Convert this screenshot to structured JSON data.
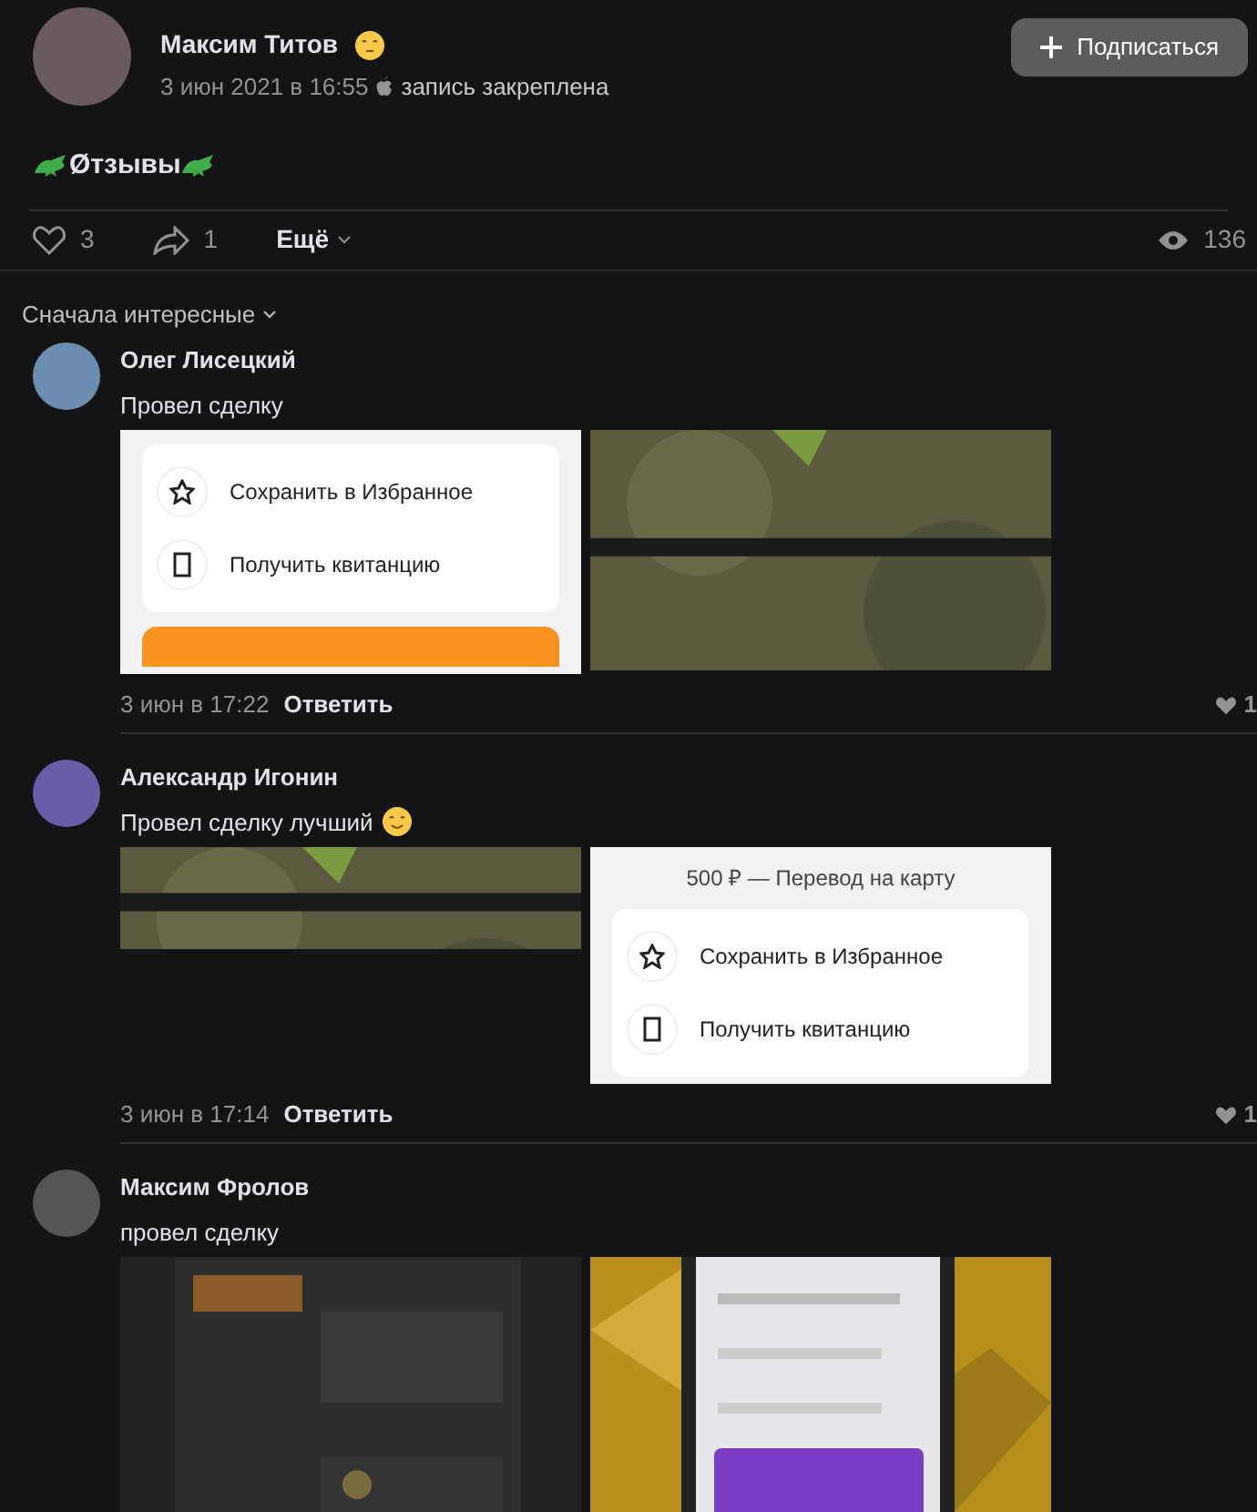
{
  "post": {
    "author": "Максим Титов",
    "date": "3 июн 2021 в 16:55",
    "pinned": "запись закреплена",
    "subscribe": "Подписаться",
    "text": "Øтзывы",
    "likes": "3",
    "shares": "1",
    "more": "Ещё",
    "views": "136"
  },
  "sort": "Сначала интересные",
  "comments": [
    {
      "author": "Олег Лисецкий",
      "text": "Провел сделку",
      "emoji": false,
      "attachments": [
        {
          "kind": "receipt",
          "options": [
            "Сохранить в Избранное",
            "Получить квитанцию"
          ],
          "banner": true
        },
        {
          "kind": "picture"
        }
      ],
      "date": "3 июн в 17:22",
      "reply": "Ответить",
      "likes": "1"
    },
    {
      "author": "Александр Игонин",
      "text": "Провел сделку лучший",
      "emoji": true,
      "attachments": [
        {
          "kind": "picture"
        },
        {
          "kind": "receipt",
          "heading": "500 ₽ — Перевод на карту",
          "options": [
            "Сохранить в Избранное",
            "Получить квитанцию"
          ],
          "banner": false
        }
      ],
      "date": "3 июн в 17:14",
      "reply": "Ответить",
      "likes": "1"
    },
    {
      "author": "Максим Фролов",
      "text": "провел сделку",
      "emoji": false,
      "attachments": [
        {
          "kind": "picture"
        },
        {
          "kind": "picture"
        }
      ]
    }
  ]
}
